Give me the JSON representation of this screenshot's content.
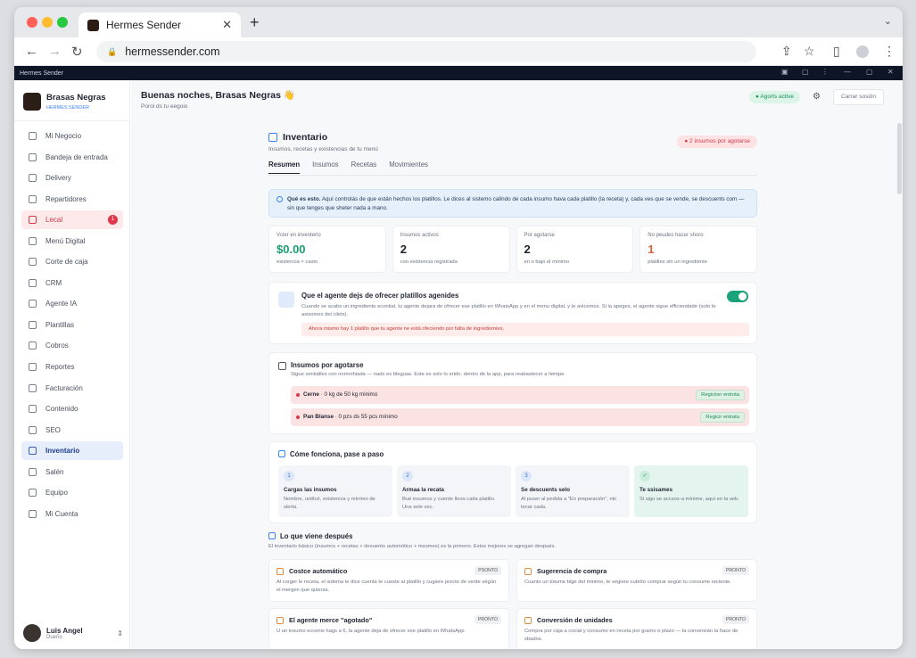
{
  "browser": {
    "tab_title": "Hermes Sender",
    "url": "hermessender.com"
  },
  "appbar": {
    "title": "Hermes Sender"
  },
  "brand": {
    "name": "Brasas Negras",
    "sub": "HERMES SENDER"
  },
  "sidebar": {
    "items": [
      {
        "label": "Mi Negocio"
      },
      {
        "label": "Bandeja de entrada"
      },
      {
        "label": "Delivery"
      },
      {
        "label": "Repartidores"
      },
      {
        "label": "Lecal",
        "badge": "1"
      },
      {
        "label": "Menú Digital"
      },
      {
        "label": "Corte de caja"
      },
      {
        "label": "CRM"
      },
      {
        "label": "Agente IA"
      },
      {
        "label": "Plantillas"
      },
      {
        "label": "Cobros"
      },
      {
        "label": "Reportes"
      },
      {
        "label": "Facturación"
      },
      {
        "label": "Contenido"
      },
      {
        "label": "SEO"
      },
      {
        "label": "Inventario"
      },
      {
        "label": "Salén"
      },
      {
        "label": "Equipo"
      },
      {
        "label": "Mi Cuenta"
      }
    ]
  },
  "user": {
    "name": "Luis Angel",
    "role": "Dueño"
  },
  "header": {
    "greeting": "Buenas noches, Brasas Negras 👋",
    "subtitle": "Porol ds tu eegoio",
    "agents": "● Agorts active",
    "logout": "Carrar sosión"
  },
  "page": {
    "title": "Inventario",
    "subtitle": "Insumos, recetas y existencias de tu menú",
    "low_pill": "● 2 insumos por agotarse",
    "tabs": [
      "Resumen",
      "Insumos",
      "Recetas",
      "Movimientes"
    ],
    "info_bold": "Qué es esto.",
    "info_text": " Aquí controlás de que están hechos los platillos. Le dices al sistemo calindo de cada insumo hava cada platillo (la receta) y, cada ves que se vende, se descuents com — sin que tenges que sheter nada a mano."
  },
  "stats": [
    {
      "label": "Vcler en inventerio",
      "value": "$0.00",
      "foot": "existencia × casto",
      "color": "#1a9e6e"
    },
    {
      "label": "Insumos activos",
      "value": "2",
      "foot": "con existencia registrada",
      "color": "#1f2430"
    },
    {
      "label": "Por agotarse",
      "value": "2",
      "foot": "en o bajo el mínimo",
      "color": "#1f2430"
    },
    {
      "label": "No peudes hacer shoro",
      "value": "1",
      "foot": "platilles sin un ingrediente",
      "color": "#d9613b"
    }
  ],
  "stop_card": {
    "title": "Que el agente dejs de ofrecer platillos agenides",
    "desc": "Cuando se acabs un ingrediente econtial, tu agente dejara de ofrecer ese platillo en WhatsApp y en el menu digital, y te avicemos. Si la apeges, el agente sigue efficiendade (solo te asisomes del cilets).",
    "warn": "Ahora mismo hay 1 platillo que tu agente ne está ofeciendo por falta de ingrediomies."
  },
  "low_card": {
    "title": "Insumos por agotarse",
    "desc": "Sigue ventiálles con normohiada — nads es bleguas. Este es solo lo erido, dentro de la app, para reabastecer a tiempe.",
    "rows": [
      {
        "bold": "Cerne",
        "text": " · 0 kg de 50 kg minimo",
        "btn": "Regicirer entrota"
      },
      {
        "bold": "Pan Blanse",
        "text": " · 0 pzs ds 55 pcs mínimo",
        "btn": "Regicir entrata"
      }
    ]
  },
  "how": {
    "title": "Cóme fonciona, pase a paso",
    "steps": [
      {
        "n": "1",
        "t": "Cargas las insumos",
        "d": "Nombre, untilcé, existencia y mínimo de slerta."
      },
      {
        "n": "2",
        "t": "Armaa la recata",
        "d": "Bué insumos y cuente lleva cada platillo. Una sele vec."
      },
      {
        "n": "3",
        "t": "Se descuents selo",
        "d": "Al puser al pedida a \"En preparación\", nin tecar cada."
      },
      {
        "n": "✓",
        "t": "Te ssisames",
        "d": "Si sigo se accsos-a mínime, aquí en la seb."
      }
    ]
  },
  "next": {
    "title": "Lo que viene después",
    "sub": "El inventario básico (insumcs + recetas + desuento automótico + msomes) es la primero. Estss mejores se agregan después.",
    "items": [
      {
        "t": "Costce automático",
        "d": "Al corger le receta, el sidema te dice cuenta te cueste al platillo y cugiere precte de vente ségún el mergen que quieras.",
        "p": "PSONTO"
      },
      {
        "t": "Sugerencia de compra",
        "d": "Cuanto un totume bige del minimo, te segiere cubrito comprar según tu conoume reciente.",
        "p": "PRONTO"
      },
      {
        "t": "El agente merce \"agotado\"",
        "d": "U un insumo eccenis hags a 6, la agente deja de ofrecer ese platillo en WhatsApp.",
        "p": "PRONTO"
      },
      {
        "t": "Conversión de unidades",
        "d": "Compra por caja a cocial y consumo en receta por gramo o plazo — la conversián la hace de sbados.",
        "p": "PRONTO"
      }
    ]
  }
}
